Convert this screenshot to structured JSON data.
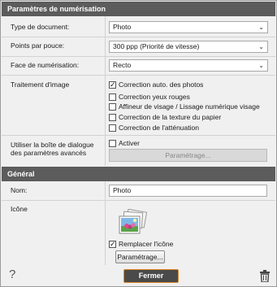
{
  "scan_settings": {
    "header": "Paramètres de numérisation",
    "document_type": {
      "label": "Type de document:",
      "value": "Photo"
    },
    "resolution": {
      "label": "Points par pouce:",
      "value": "300 ppp (Priorité de vitesse)"
    },
    "scan_side": {
      "label": "Face de numérisation:",
      "value": "Recto"
    },
    "image_processing": {
      "label": "Traitement d'image",
      "options": [
        {
          "label": "Correction auto. des photos",
          "checked": true
        },
        {
          "label": "Correction yeux rouges",
          "checked": false
        },
        {
          "label": "Affineur de visage / Lissage numérique visage",
          "checked": false
        },
        {
          "label": "Correction de la texture du papier",
          "checked": false
        },
        {
          "label": "Correction de l'atténuation",
          "checked": false
        }
      ]
    },
    "advanced": {
      "label_line1": "Utiliser la boîte de dialogue",
      "label_line2": "des paramètres avancés",
      "activate_label": "Activer",
      "setup_button": "Paramétrage..."
    }
  },
  "general": {
    "header": "Général",
    "name": {
      "label": "Nom:",
      "value": "Photo"
    },
    "icon": {
      "label": "Icône",
      "replace_label": "Remplacer l'icône",
      "replace_checked": true,
      "setup_button": "Paramétrage..."
    }
  },
  "footer": {
    "help_icon": "?",
    "close_button": "Fermer",
    "trash_icon": "trash-icon"
  }
}
